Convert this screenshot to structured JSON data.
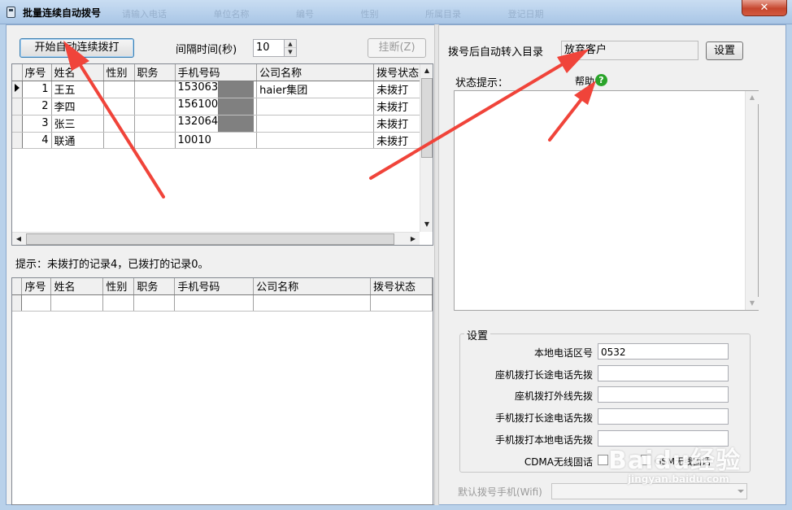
{
  "window": {
    "title": "批量连续自动拨号",
    "close_glyph": "✕"
  },
  "toolbar": {
    "start_button": "开始自动连续拨打",
    "interval_label": "间隔时间(秒)",
    "interval_value": "10",
    "hangup_button": "挂断(Z)"
  },
  "top_grid": {
    "columns": [
      "序号",
      "姓名",
      "性别",
      "职务",
      "手机号码",
      "公司名称",
      "拨号状态"
    ],
    "rows": [
      {
        "no": "1",
        "name": "王五",
        "gender": "",
        "title": "",
        "phone": "153063",
        "company": "haier集团",
        "status": "未拨打"
      },
      {
        "no": "2",
        "name": "李四",
        "gender": "",
        "title": "",
        "phone": "156100",
        "company": "",
        "status": "未拨打"
      },
      {
        "no": "3",
        "name": "张三",
        "gender": "",
        "title": "",
        "phone": "132064",
        "company": "",
        "status": "未拨打"
      },
      {
        "no": "4",
        "name": "联通",
        "gender": "",
        "title": "",
        "phone": "10010",
        "company": "",
        "status": "未拨打"
      }
    ]
  },
  "hint": {
    "text": "提示：未拨打的记录4，已拨打的记录0。"
  },
  "bottom_grid": {
    "columns": [
      "序号",
      "姓名",
      "性别",
      "职务",
      "手机号码",
      "公司名称",
      "拨号状态"
    ]
  },
  "right_panel": {
    "auto_move_label": "拨号后自动转入目录",
    "auto_move_value": "放弃客户",
    "set_button": "设置",
    "status_label": "状态提示：",
    "help_label": "帮助",
    "help_glyph": "?"
  },
  "settings": {
    "group_title": "设置",
    "area_code_label": "本地电话区号",
    "area_code_value": "0532",
    "landline_long_label": "座机拨打长途电话先拨",
    "landline_outside_label": "座机拨打外线先拨",
    "mobile_long_label": "手机拨打长途电话先拨",
    "mobile_local_label": "手机拨打本地电话先拨",
    "cdma_label": "CDMA无线固话",
    "gsm_label": "GSM无线固话"
  },
  "default_phone": {
    "label": "默认拨号手机(Wifi)"
  },
  "watermark": {
    "brand": "Baidu经验",
    "url": "jingyan.baidu.com"
  },
  "colors": {
    "arrow": "#f0443a",
    "help_icon": "#2aa42a",
    "mask": "#808080"
  },
  "titlebar_ghost": [
    "请输入电话",
    "单位名称",
    "编号",
    "性别",
    "所属目录",
    "登记日期"
  ]
}
